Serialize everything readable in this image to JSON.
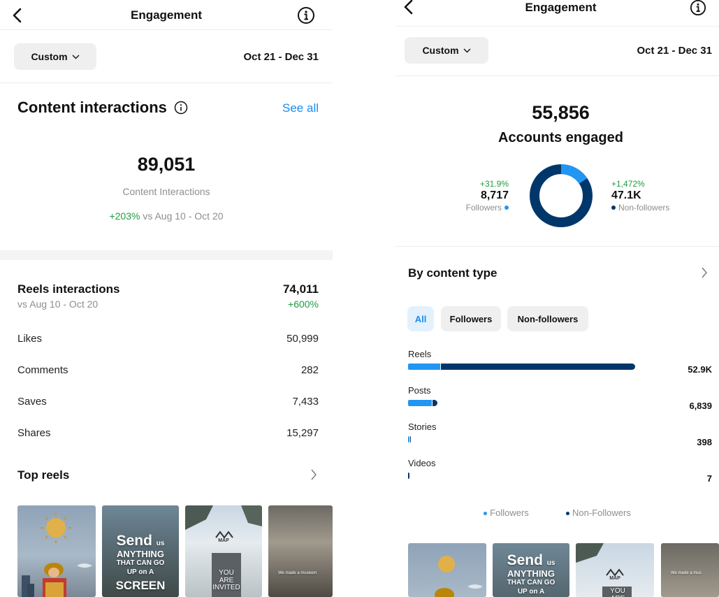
{
  "colors": {
    "followers": "#2196f3",
    "non_followers": "#00376b",
    "positive": "#1f9c3f",
    "link": "#1a8cf0"
  },
  "left": {
    "header": {
      "title": "Engagement",
      "back_icon": "chevron-left-icon",
      "info_icon": "info-icon"
    },
    "filter": {
      "range_label": "Custom",
      "date_range": "Oct 21 - Dec 31"
    },
    "content_interactions": {
      "title": "Content interactions",
      "see_all": "See all",
      "total": "89,051",
      "total_label": "Content Interactions",
      "change": "+203%",
      "compare": "vs Aug 10 - Oct 20"
    },
    "reels": {
      "title": "Reels interactions",
      "subtitle": "vs Aug 10 - Oct 20",
      "total": "74,011",
      "change": "+600%",
      "rows": [
        {
          "label": "Likes",
          "value": "50,999"
        },
        {
          "label": "Comments",
          "value": "282"
        },
        {
          "label": "Saves",
          "value": "7,433"
        },
        {
          "label": "Shares",
          "value": "15,297"
        }
      ]
    },
    "top_reels": {
      "title": "Top reels",
      "thumbs": [
        {
          "text": ""
        },
        {
          "text_big": "Send",
          "text_small": "us",
          "text_mid": "ANYTHING",
          "text_mid2": "THAT CAN GO",
          "text_mid3": "UP on A",
          "text_end": "SCREEN"
        },
        {
          "logo": "MAP",
          "sign": "YOU ARE INVITED"
        },
        {
          "caption": "We made a museum"
        }
      ]
    }
  },
  "right": {
    "header": {
      "title": "Engagement"
    },
    "filter": {
      "range_label": "Custom",
      "date_range": "Oct 21 - Dec 31"
    },
    "accounts": {
      "total": "55,856",
      "label": "Accounts engaged",
      "followers": {
        "change": "+31.9%",
        "value": "8,717",
        "label": "Followers",
        "share": 0.156
      },
      "non_followers": {
        "change": "+1,472%",
        "value": "47.1K",
        "label": "Non-followers",
        "share": 0.844
      }
    },
    "by_content_type": {
      "title": "By content type",
      "tabs": [
        {
          "label": "All",
          "active": true
        },
        {
          "label": "Followers",
          "active": false
        },
        {
          "label": "Non-followers",
          "active": false
        }
      ],
      "rows": [
        {
          "label": "Reels",
          "value": "52.9K",
          "total": 52900,
          "followers_share": 0.14
        },
        {
          "label": "Posts",
          "value": "6,839",
          "total": 6839,
          "followers_share": 0.8
        },
        {
          "label": "Stories",
          "value": "398",
          "total": 398,
          "followers_share": 0.5
        },
        {
          "label": "Videos",
          "value": "7",
          "total": 7,
          "followers_share": 0
        }
      ],
      "legend": {
        "followers": "Followers",
        "non_followers": "Non-Followers"
      }
    },
    "top_reels": {
      "thumbs": [
        {
          "text": ""
        },
        {
          "text_big": "Send",
          "text_small": "us",
          "text_mid": "ANYTHING",
          "text_mid2": "THAT CAN GO",
          "text_mid3": "UP on A"
        },
        {
          "logo": "MAP",
          "sign": "YOU ARE"
        },
        {
          "caption": "We made a mus"
        }
      ]
    }
  }
}
